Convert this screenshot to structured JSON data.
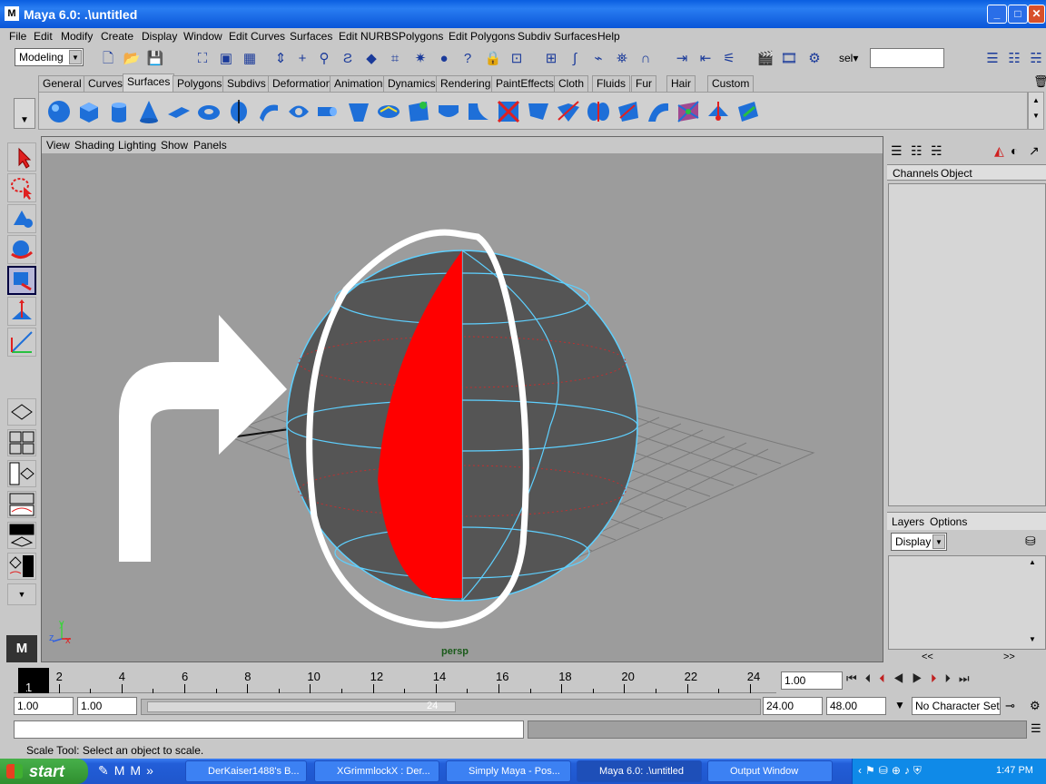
{
  "window": {
    "title": "Maya 6.0: .\\untitled",
    "app_icon": "M"
  },
  "menubar": [
    "File",
    "Edit",
    "Modify",
    "Create",
    "Display",
    "Window",
    "Edit Curves",
    "Surfaces",
    "Edit NURBS",
    "Polygons",
    "Edit Polygons",
    "Subdiv Surfaces",
    "Help"
  ],
  "statusline": {
    "mode": "Modeling",
    "sel_label": "sel"
  },
  "shelf": {
    "tabs": [
      "General",
      "Curves",
      "Surfaces",
      "Polygons",
      "Subdivs",
      "Deformation",
      "Animation",
      "Dynamics",
      "Rendering",
      "PaintEffects",
      "Cloth",
      "Fluids",
      "Fur",
      "Hair",
      "Custom"
    ],
    "active_tab": "Surfaces"
  },
  "viewport": {
    "menu": [
      "View",
      "Shading",
      "Lighting",
      "Show",
      "Panels"
    ],
    "camera_label": "persp",
    "axis": {
      "x": "x",
      "y": "y",
      "z": "z"
    }
  },
  "channelbox": {
    "menu": [
      "Channels",
      "Object"
    ]
  },
  "layers": {
    "menu": [
      "Layers",
      "Options"
    ],
    "display_option": "Display",
    "scroll_left": "<<",
    "scroll_right": ">>"
  },
  "timeline": {
    "ticks": [
      "2",
      "4",
      "6",
      "8",
      "10",
      "12",
      "14",
      "16",
      "18",
      "20",
      "22",
      "24"
    ],
    "current_frame": "1",
    "current_time_field": "1.00"
  },
  "range": {
    "start": "1.00",
    "playback_start": "1.00",
    "slider_end_label": "24",
    "playback_end": "24.00",
    "end": "48.00",
    "character_set": "No Character Set"
  },
  "helpline": "Scale Tool: Select an object to scale.",
  "taskbar": {
    "start": "start",
    "tasks": [
      "DerKaiser1488's B...",
      "XGrimmlockX : Der...",
      "Simply Maya - Pos...",
      "Maya 6.0: .\\untitled",
      "Output Window"
    ],
    "clock": "1:47 PM"
  },
  "colors": {
    "accent": "#ff0000",
    "wire": "#5ed0ff",
    "viewport_bg": "#9c9c9c"
  }
}
